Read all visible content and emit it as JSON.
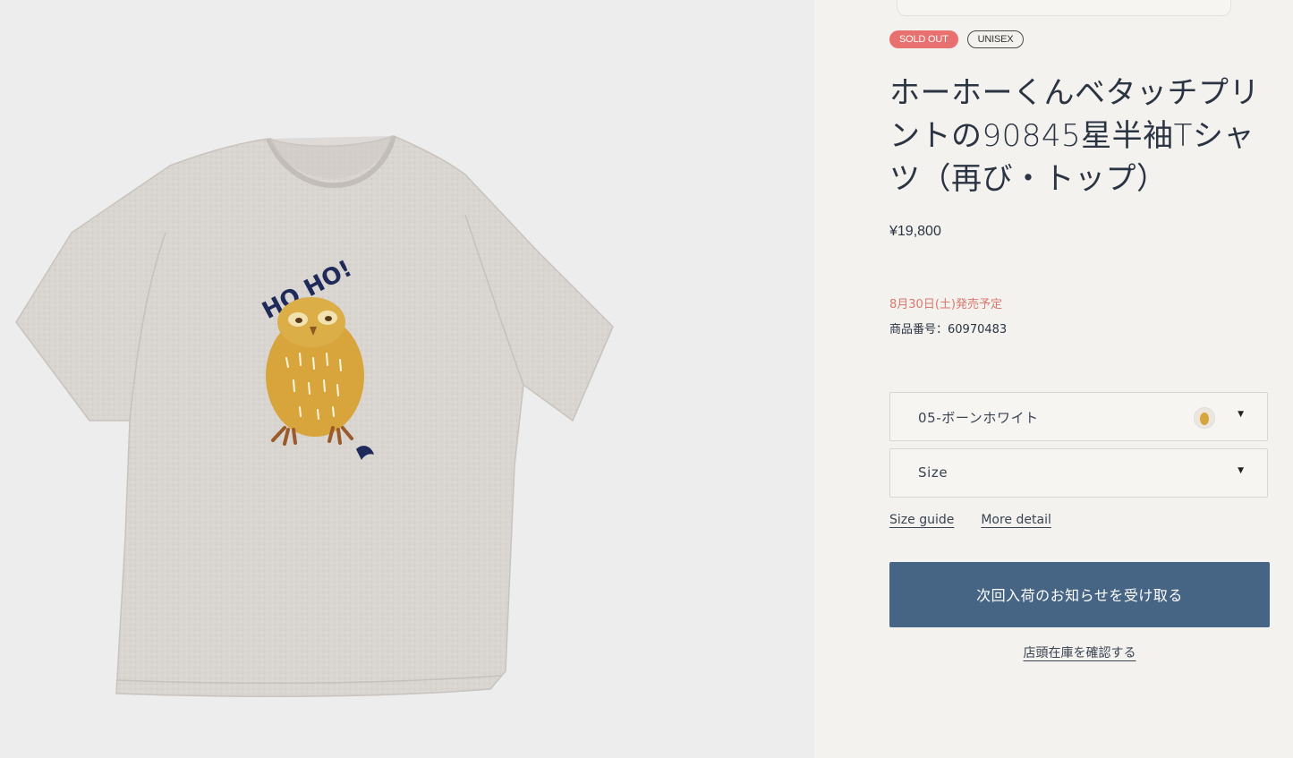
{
  "product": {
    "badges": {
      "sold_out": "SOLD OUT",
      "unisex": "UNISEX"
    },
    "title": "ホーホーくんベタッチプリントの90845星半袖Tシャツ（再び・トップ）",
    "price": "¥19,800",
    "release_date": "8月30日(土)発売予定",
    "sku": "商品番号：60970483",
    "print_text": "HO HO!"
  },
  "options": {
    "color": {
      "value": "05-ボーンホワイト",
      "swatch_icon": "owl-swatch-icon"
    },
    "size": {
      "placeholder": "Size"
    }
  },
  "links": {
    "size_guide": "Size guide",
    "more_detail": "More detail"
  },
  "actions": {
    "notify": "次回入荷のお知らせを受け取る",
    "store_stock": "店頭在庫を確認する"
  },
  "colors": {
    "sold_out_badge": "#e8706e",
    "button": "#466584",
    "release_text": "#d9776d",
    "shirt": "#d8d4d0",
    "owl": "#d8a53c",
    "print_navy": "#1e2a5a"
  }
}
